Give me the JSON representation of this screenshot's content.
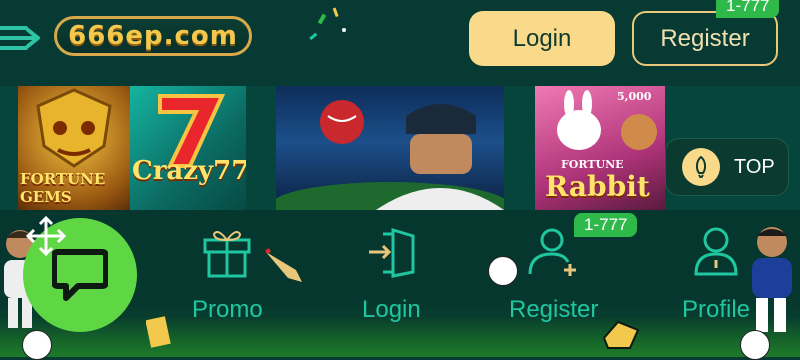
{
  "header": {
    "logo_text": "666ep.com",
    "login_label": "Login",
    "register_label": "Register",
    "register_badge": "1-777"
  },
  "banners": {
    "fortune_gems": "FORTUNE GEMS",
    "crazy": "Crazy777",
    "fortune_rabbit_small": "FORTUNE",
    "fortune_rabbit": "Rabbit",
    "rabbit_value": "5,000"
  },
  "top_button": {
    "label": "TOP"
  },
  "nav": {
    "items": [
      {
        "label": "Promo"
      },
      {
        "label": "Login"
      },
      {
        "label": "Register",
        "badge": "1-777"
      },
      {
        "label": "Profile"
      }
    ]
  },
  "colors": {
    "background": "#063a33",
    "accent": "#f9d98a",
    "nav_text": "#1fc6a0",
    "badge": "#2fb94a",
    "chat": "#5fd643"
  }
}
